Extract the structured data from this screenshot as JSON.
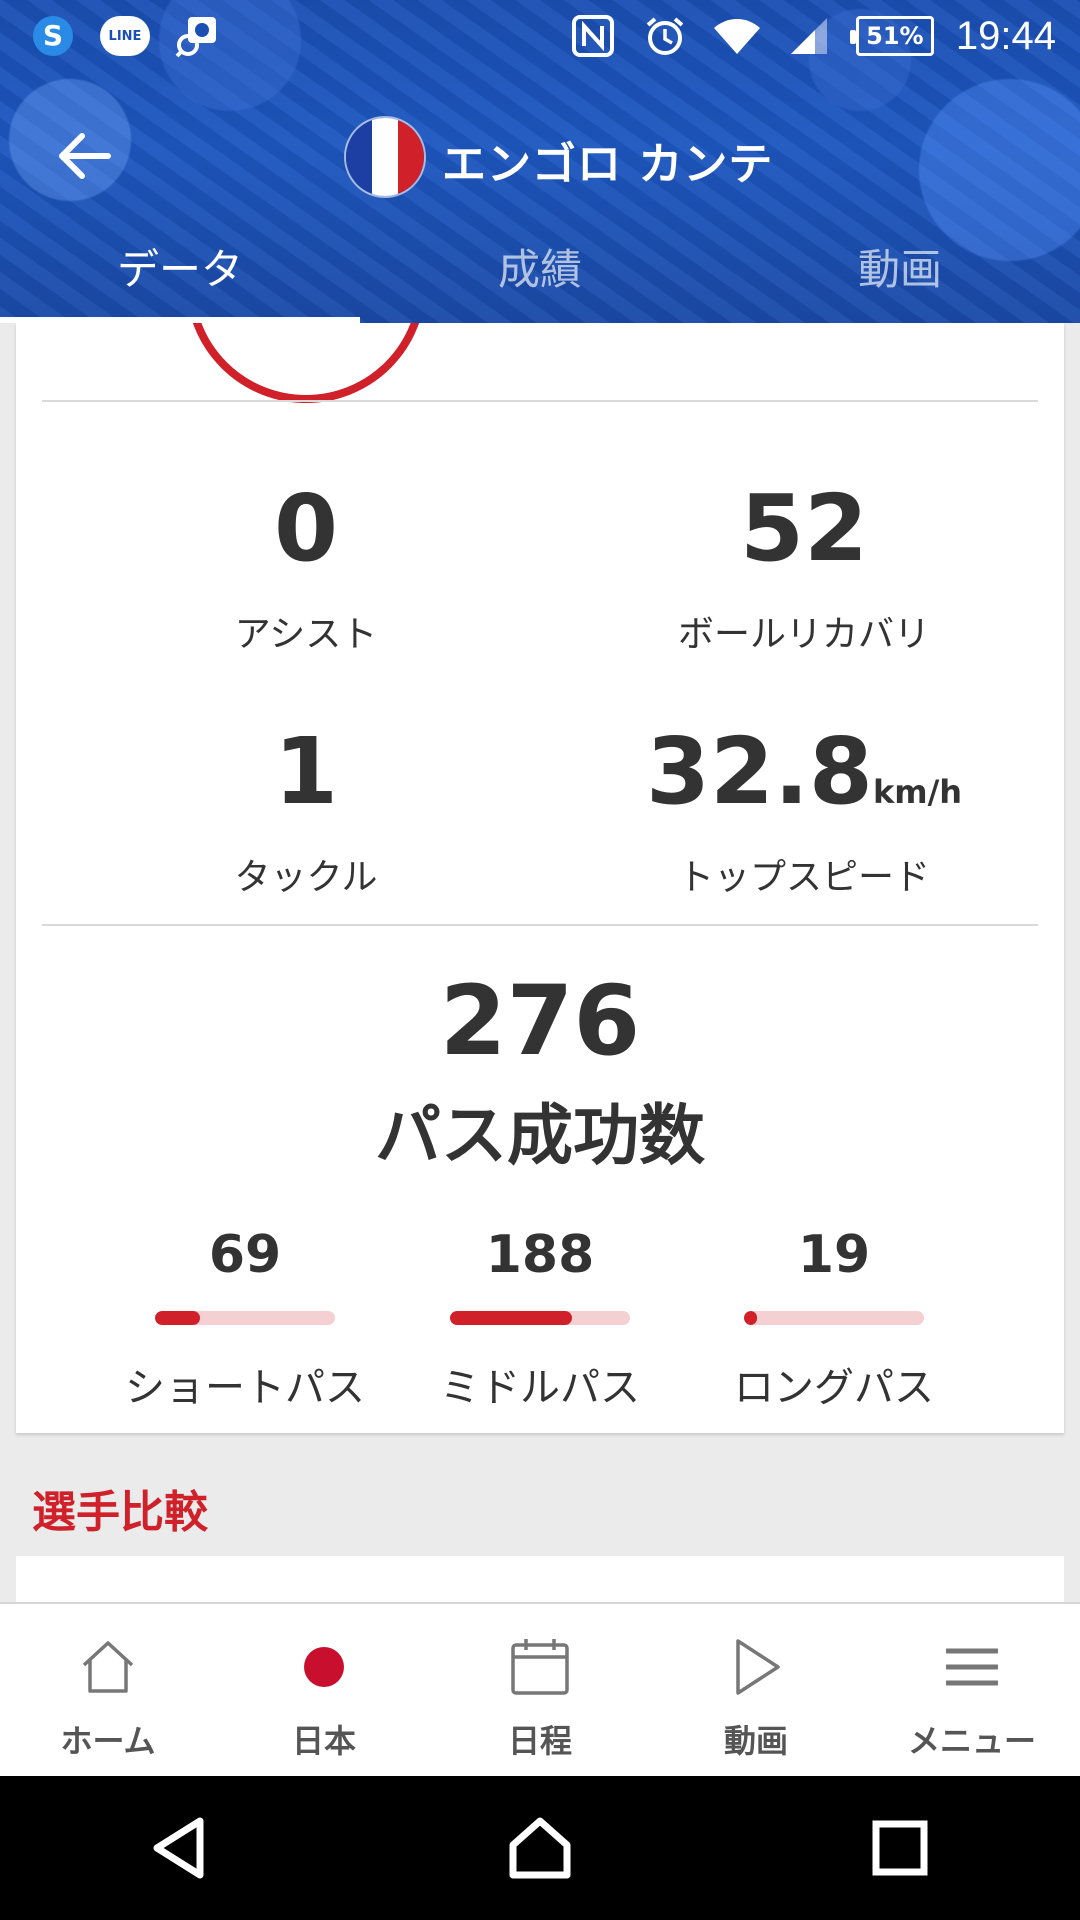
{
  "status_bar": {
    "line_label": "LINE",
    "battery": "51%",
    "time": "19:44"
  },
  "app_bar": {
    "player_name": "エンゴロ カンテ",
    "flag_colors": [
      "#1d3fa3",
      "#ffffff",
      "#d0202a"
    ]
  },
  "tabs": [
    {
      "label": "データ",
      "active": true
    },
    {
      "label": "成績",
      "active": false
    },
    {
      "label": "動画",
      "active": false
    }
  ],
  "stats": {
    "assist": {
      "value": "0",
      "label": "アシスト"
    },
    "ball_recovery": {
      "value": "52",
      "label": "ボールリカバリ"
    },
    "tackle": {
      "value": "1",
      "label": "タックル"
    },
    "top_speed": {
      "value": "32.8",
      "unit": "km/h",
      "label": "トップスピード"
    }
  },
  "passes": {
    "total": "276",
    "title": "パス成功数",
    "items": [
      {
        "value": "69",
        "label": "ショートパス",
        "fraction": 0.25
      },
      {
        "value": "188",
        "label": "ミドルパス",
        "fraction": 0.68
      },
      {
        "value": "19",
        "label": "ロングパス",
        "fraction": 0.07
      }
    ]
  },
  "section": {
    "title": "選手比較"
  },
  "bottom_nav": [
    {
      "label": "ホーム",
      "icon": "home-icon"
    },
    {
      "label": "日本",
      "icon": "japan-flag-icon"
    },
    {
      "label": "日程",
      "icon": "calendar-icon"
    },
    {
      "label": "動画",
      "icon": "play-icon"
    },
    {
      "label": "メニュー",
      "icon": "menu-icon"
    }
  ],
  "colors": {
    "accent": "#d0202a",
    "header": "#1a4fb3"
  }
}
